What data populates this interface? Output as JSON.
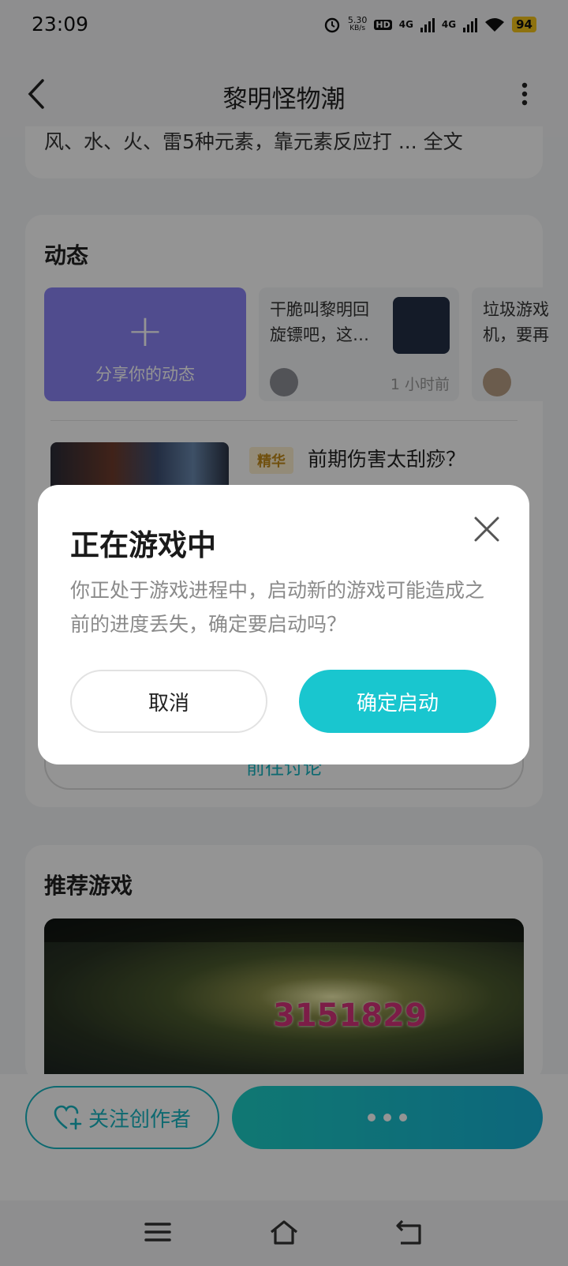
{
  "status_bar": {
    "time": "23:09",
    "net_speed_value": "5.30",
    "net_speed_unit": "KB/s",
    "hd_label": "HD",
    "sim1_type": "4G",
    "sim2_type": "4G",
    "battery": "94"
  },
  "header": {
    "title": "黎明怪物潮",
    "desc_snippet": "风、水、火、雷5种元素，靠元素反应打 ... 全文"
  },
  "feed": {
    "section_title": "动态",
    "share_label": "分享你的动态",
    "posts": [
      {
        "text_line1": "干脆叫黎明回",
        "text_line2": "旋镖吧，这…",
        "time": "1 小时前"
      },
      {
        "text_line1": "垃圾游戏",
        "text_line2": "机，要再",
        "time": ""
      }
    ],
    "article": {
      "tag": "精华",
      "title": "前期伤害太刮痧？"
    },
    "discuss_label": "前往讨论"
  },
  "recommend": {
    "section_title": "推荐游戏",
    "damage_number": "3151829"
  },
  "bottom": {
    "follow_label": "关注创作者"
  },
  "dialog": {
    "title": "正在游戏中",
    "message": "你正处于游戏进程中，启动新的游戏可能造成之前的进度丢失，确定要启动吗？",
    "cancel_label": "取消",
    "confirm_label": "确定启动"
  },
  "colors": {
    "accent": "#19c6cf",
    "share_tile": "#8a84f5",
    "tag_bg": "#fdf0cf",
    "tag_text": "#c28a19"
  },
  "icons": [
    "back-icon",
    "more-icon",
    "plus-icon",
    "close-icon",
    "heart-plus-icon",
    "menu-icon",
    "home-icon",
    "back-nav-icon",
    "alarm-icon",
    "wifi-icon",
    "signal-icon"
  ]
}
